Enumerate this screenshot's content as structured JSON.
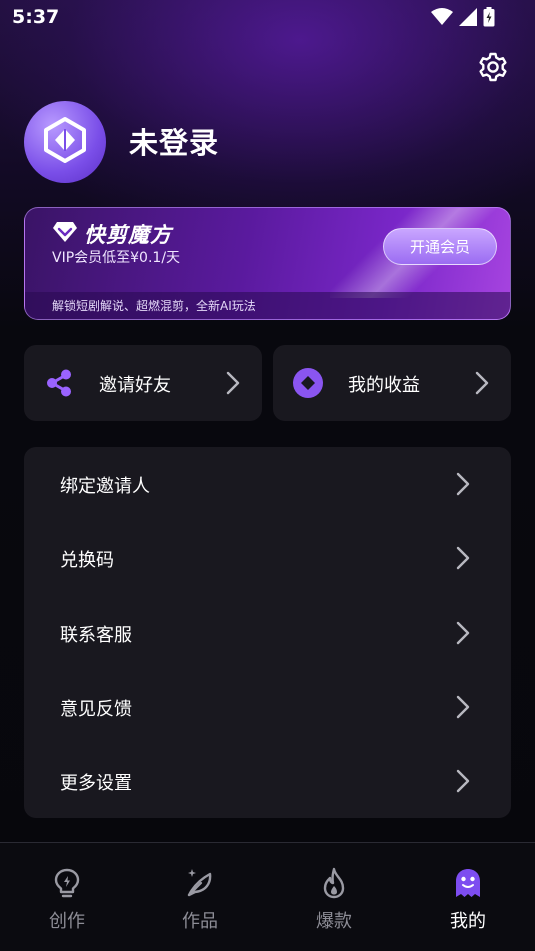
{
  "status_bar": {
    "time": "5:37"
  },
  "profile": {
    "username": "未登录"
  },
  "vip": {
    "brand": "快剪魔方",
    "subtitle": "VIP会员低至¥0.1/天",
    "button_label": "开通会员",
    "footer": "解锁短剧解说、超燃混剪，全新AI玩法"
  },
  "cards": {
    "invite_label": "邀请好友",
    "income_label": "我的收益"
  },
  "menu": [
    {
      "label": "绑定邀请人"
    },
    {
      "label": "兑换码"
    },
    {
      "label": "联系客服"
    },
    {
      "label": "意见反馈"
    },
    {
      "label": "更多设置"
    }
  ],
  "tabs": [
    {
      "label": "创作",
      "icon": "bulb-icon"
    },
    {
      "label": "作品",
      "icon": "feather-icon"
    },
    {
      "label": "爆款",
      "icon": "flame-icon"
    },
    {
      "label": "我的",
      "icon": "ghost-icon",
      "active": true
    }
  ],
  "colors": {
    "accent": "#7a4ee8",
    "card_bg": "#19181f",
    "page_bg": "#07070c"
  }
}
